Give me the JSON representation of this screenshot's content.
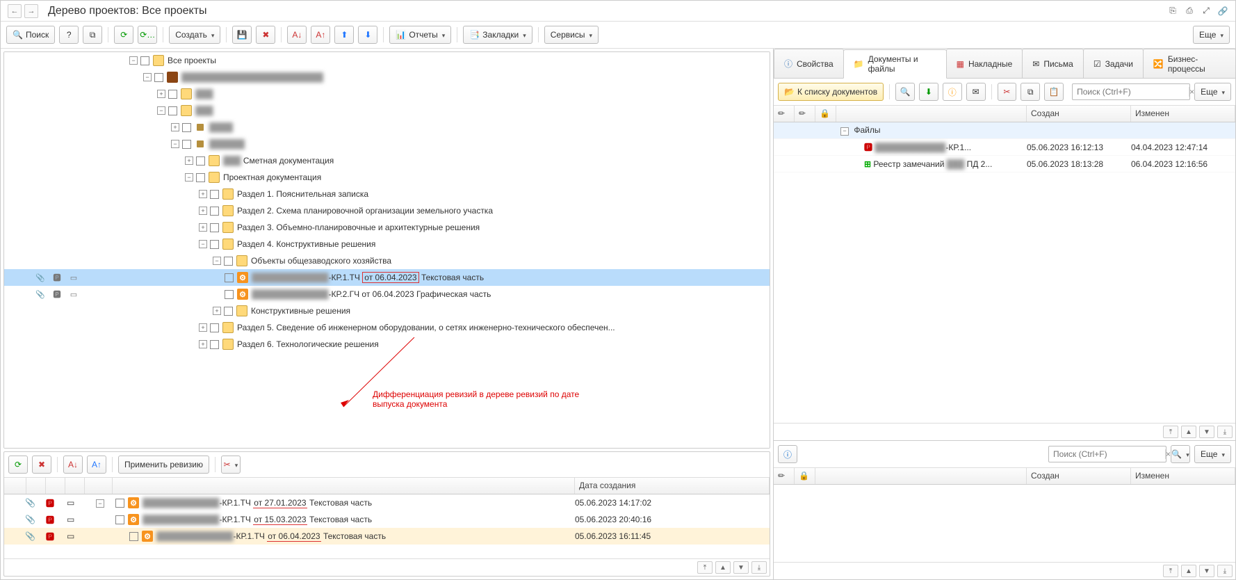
{
  "titlebar": {
    "back": "←",
    "forward": "→",
    "title": "Дерево проектов: Все проекты"
  },
  "title_icons": [
    "⎘",
    "⎙",
    "⤢",
    "🔗"
  ],
  "tb": {
    "search": "Поиск",
    "help": "?",
    "create": "Создать",
    "reports": "Отчеты",
    "bookmarks": "Закладки",
    "services": "Сервисы",
    "more": "Еще"
  },
  "tree": {
    "root": "Все проекты",
    "l1": "",
    "l2": "",
    "l3": "",
    "node3a": "",
    "node3b": "",
    "smeta": "Сметная документация",
    "proj": "Проектная документация",
    "r1": "Раздел 1. Пояснительная записка",
    "r2": "Раздел 2. Схема планировочной организации земельного участка",
    "r3": "Раздел 3. Объемно-планировочные и архитектурные решения",
    "r4": "Раздел 4. Конструктивные решения",
    "r4a": "Объекты общезаводского хозяйства",
    "doc1_pre": "",
    "doc1_suf": "-КР.1.ТЧ",
    "doc1_date": "от 06.04.2023",
    "doc1_name": "Текстовая часть",
    "doc2_pre": "",
    "doc2_suf": "-КР.2.ГЧ от 06.04.2023 Графическая часть",
    "r4b": "Конструктивные решения",
    "r5": "Раздел 5. Сведение об инженерном оборудовании, о сетях инженерно-технического обеспечен...",
    "r6": "Раздел 6. Технологические решения"
  },
  "annot": {
    "text": "Дифференциация ревизий в дереве ревизий по дате выпуска документа"
  },
  "rev": {
    "apply": "Применить ревизию",
    "date_h": "Дата создания",
    "rows": [
      {
        "name_suf": "-КР.1.ТЧ",
        "d": "от 27.01.2023",
        "t": "Текстовая часть",
        "created": "05.06.2023 14:17:02"
      },
      {
        "name_suf": "-КР.1.ТЧ",
        "d": "от 15.03.2023",
        "t": "Текстовая часть",
        "created": "05.06.2023 20:40:16"
      },
      {
        "name_suf": "-КР.1.ТЧ",
        "d": "от 06.04.2023",
        "t": "Текстовая часть",
        "created": "05.06.2023 16:11:45"
      }
    ]
  },
  "right_tabs": {
    "t1": "Свойства",
    "t2": "Документы и файлы",
    "t3": "Накладные",
    "t4": "Письма",
    "t5": "Задачи",
    "t6": "Бизнес-процессы"
  },
  "right": {
    "tolist": "К списку документов",
    "more": "Еще",
    "search_ph": "Поиск (Ctrl+F)",
    "h_created": "Создан",
    "h_modified": "Изменен",
    "files": "Файлы",
    "f1": {
      "name": "-КР.1...",
      "created": "05.06.2023 16:12:13",
      "modified": "04.04.2023 12:47:14"
    },
    "f2": {
      "name_pre": "Реестр замечаний ",
      "name_suf": " ПД 2...",
      "created": "05.06.2023 18:13:28",
      "modified": "06.04.2023 12:16:56"
    }
  },
  "rlow": {
    "search_ph": "Поиск (Ctrl+F)",
    "h_created": "Создан",
    "h_modified": "Изменен"
  }
}
